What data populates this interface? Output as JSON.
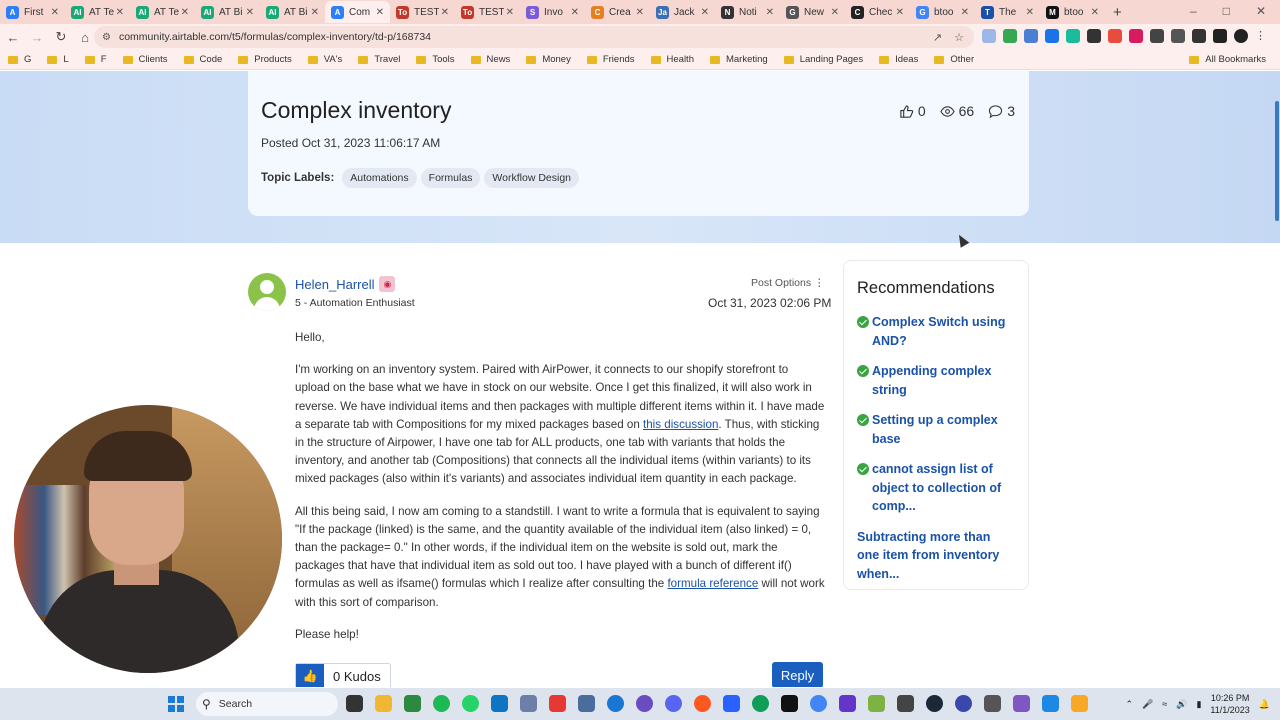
{
  "browser": {
    "tabs": [
      {
        "label": "First",
        "color": "#2d7ff9",
        "glyph": "A"
      },
      {
        "label": "AT Te",
        "color": "#19a974",
        "glyph": "AI"
      },
      {
        "label": "AT Te",
        "color": "#19a974",
        "glyph": "AI"
      },
      {
        "label": "AT Bi",
        "color": "#19a974",
        "glyph": "AI"
      },
      {
        "label": "AT Bi",
        "color": "#19a974",
        "glyph": "AI"
      },
      {
        "label": "Com",
        "color": "#2d7ff9",
        "glyph": "A"
      },
      {
        "label": "TEST",
        "color": "#c0392b",
        "glyph": "To"
      },
      {
        "label": "TEST",
        "color": "#c0392b",
        "glyph": "To"
      },
      {
        "label": "Invo",
        "color": "#7b5cd6",
        "glyph": "S"
      },
      {
        "label": "Crea",
        "color": "#e67e22",
        "glyph": "C"
      },
      {
        "label": "Jack",
        "color": "#3d6fb6",
        "glyph": "Ja"
      },
      {
        "label": "Noti",
        "color": "#333333",
        "glyph": "N"
      },
      {
        "label": "New",
        "color": "#555555",
        "glyph": "G"
      },
      {
        "label": "Chec",
        "color": "#222222",
        "glyph": "C"
      },
      {
        "label": "btoo",
        "color": "#4285f4",
        "glyph": "G"
      },
      {
        "label": "The",
        "color": "#1a4fa8",
        "glyph": "T"
      },
      {
        "label": "btoo",
        "color": "#111111",
        "glyph": "M"
      }
    ],
    "active_tab_index": 5,
    "url": "community.airtable.com/t5/formulas/complex-inventory/td-p/168734",
    "bookmarks": [
      "G",
      "L",
      "F",
      "Clients",
      "Code",
      "Products",
      "VA's",
      "Travel",
      "Tools",
      "News",
      "Money",
      "Friends",
      "Health",
      "Marketing",
      "Landing Pages",
      "Ideas",
      "Other"
    ],
    "all_bookmarks_label": "All Bookmarks"
  },
  "post": {
    "title": "Complex inventory",
    "posted": "Posted Oct 31, 2023 11:06:17 AM",
    "topic_labels_heading": "Topic Labels:",
    "topic_labels": [
      "Automations",
      "Formulas",
      "Workflow Design"
    ],
    "stats": {
      "likes": "0",
      "views": "66",
      "comments": "3"
    },
    "author": "Helen_Harrell",
    "rank": "5 - Automation Enthusiast",
    "post_options": "Post Options",
    "date": "Oct 31, 2023 02:06 PM",
    "greeting": "Hello,",
    "para1_a": "I'm working on an inventory system.  Paired with AirPower, it connects to our shopify storefront to upload on the base what we have in stock on our website.  Once I get this finalized, it will also work in reverse.  We have individual items and then packages with multiple different items within it.  I have made a separate tab with Compositions for my mixed packages based on ",
    "para1_link": "this discussion",
    "para1_b": ".    Thus, with sticking in the structure of Airpower, I have one tab for ALL products, one tab with variants that holds the inventory, and another tab (Compositions) that connects all the individual items (within variants) to its mixed packages (also within it's variants) and associates individual item quantity in each package.",
    "para2_a": "All this being said, I now am coming to a standstill.  I want to write a formula that is equivalent to saying \"If the package (linked) is the same, and the quantity available of the individual item (also linked) = 0, than the package= 0.\"  In other words, if the individual item on the website is sold out, mark the packages that have that individual item as sold out too.  I have played with a bunch of different if() formulas as well as ifsame() formulas which I realize after consulting the ",
    "para2_link": "formula reference",
    "para2_b": " will not work with this sort of comparison.",
    "closing": "Please help!",
    "kudos_label": "0 Kudos",
    "reply_label": "Reply"
  },
  "recommendations": {
    "title": "Recommendations",
    "items": [
      {
        "label": "Complex Switch using AND?",
        "solved": true
      },
      {
        "label": "Appending complex string",
        "solved": true
      },
      {
        "label": "Setting up a complex base",
        "solved": true
      },
      {
        "label": "cannot assign list of object to collection of comp...",
        "solved": true
      },
      {
        "label": "Subtracting more than one item from inventory when...",
        "solved": false
      }
    ]
  },
  "taskbar": {
    "search_label": "Search",
    "time": "10:26 PM",
    "date": "11/1/2023"
  }
}
